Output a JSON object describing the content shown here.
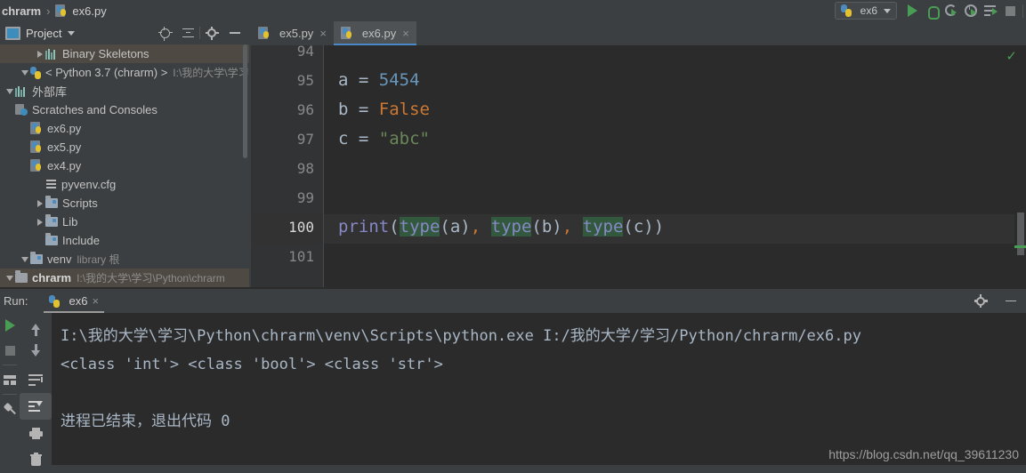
{
  "breadcrumb": {
    "project": "chrarm",
    "separator": "›",
    "file": "ex6.py"
  },
  "toolbar": {
    "run_config": "ex6",
    "buttons": [
      "run",
      "debug",
      "run-with-coverage",
      "profile",
      "run-console",
      "stop"
    ]
  },
  "project_panel": {
    "title": "Project",
    "tools": [
      "locate",
      "collapse-all",
      "settings",
      "hide"
    ],
    "tree": [
      {
        "label": "chrarm",
        "detail": "I:\\我的大学\\学习\\Python\\chrarm",
        "indent": 0,
        "twisty": "down",
        "icon": "folder",
        "bold": true,
        "selected": true
      },
      {
        "label": "venv",
        "detail": "library 根",
        "indent": 1,
        "twisty": "down",
        "icon": "folder-blue",
        "bold": false,
        "selected": false
      },
      {
        "label": "Include",
        "detail": "",
        "indent": 2,
        "twisty": "none",
        "icon": "folder-blue",
        "bold": false,
        "selected": false
      },
      {
        "label": "Lib",
        "detail": "",
        "indent": 2,
        "twisty": "right",
        "icon": "folder-blue",
        "bold": false,
        "selected": false
      },
      {
        "label": "Scripts",
        "detail": "",
        "indent": 2,
        "twisty": "right",
        "icon": "folder-blue",
        "bold": false,
        "selected": false
      },
      {
        "label": "pyvenv.cfg",
        "detail": "",
        "indent": 2,
        "twisty": "none",
        "icon": "config",
        "bold": false,
        "selected": false
      },
      {
        "label": "ex4.py",
        "detail": "",
        "indent": 1,
        "twisty": "none",
        "icon": "python-file",
        "bold": false,
        "selected": false
      },
      {
        "label": "ex5.py",
        "detail": "",
        "indent": 1,
        "twisty": "none",
        "icon": "python-file",
        "bold": false,
        "selected": false
      },
      {
        "label": "ex6.py",
        "detail": "",
        "indent": 1,
        "twisty": "none",
        "icon": "python-file",
        "bold": false,
        "selected": false
      },
      {
        "label": "Scratches and Consoles",
        "detail": "",
        "indent": 0,
        "twisty": "none",
        "icon": "scratch",
        "bold": false,
        "selected": false
      },
      {
        "label": "外部库",
        "detail": "",
        "indent": 0,
        "twisty": "down",
        "icon": "bars",
        "bold": false,
        "selected": false
      },
      {
        "label": "< Python 3.7 (chrarm) >",
        "detail": "I:\\我的大学\\学习",
        "indent": 1,
        "twisty": "down",
        "icon": "python",
        "bold": false,
        "selected": false
      },
      {
        "label": "Binary Skeletons",
        "detail": "",
        "indent": 2,
        "twisty": "right",
        "icon": "bars",
        "bold": false,
        "selected": true
      }
    ]
  },
  "editor": {
    "tabs": [
      {
        "label": "ex5.py",
        "active": false,
        "close": "×"
      },
      {
        "label": "ex6.py",
        "active": true,
        "close": "×"
      }
    ],
    "inspection_status": "✓",
    "lines": [
      {
        "number": "94",
        "current": false,
        "tokens": []
      },
      {
        "number": "95",
        "current": false,
        "tokens": [
          {
            "text": "a ",
            "cls": "punct"
          },
          {
            "text": "= ",
            "cls": "punct"
          },
          {
            "text": "5454",
            "cls": "num"
          }
        ]
      },
      {
        "number": "96",
        "current": false,
        "tokens": [
          {
            "text": "b ",
            "cls": "punct"
          },
          {
            "text": "= ",
            "cls": "punct"
          },
          {
            "text": "False",
            "cls": "kw"
          }
        ]
      },
      {
        "number": "97",
        "current": false,
        "tokens": [
          {
            "text": "c ",
            "cls": "punct"
          },
          {
            "text": "= ",
            "cls": "punct"
          },
          {
            "text": "\"abc\"",
            "cls": "str"
          }
        ]
      },
      {
        "number": "98",
        "current": false,
        "tokens": []
      },
      {
        "number": "99",
        "current": false,
        "tokens": []
      },
      {
        "number": "100",
        "current": true,
        "tokens": [
          {
            "text": "print",
            "cls": "fn"
          },
          {
            "text": "(",
            "cls": "punct"
          },
          {
            "text": "type",
            "cls": "fn hl"
          },
          {
            "text": "(a)",
            "cls": "punct"
          },
          {
            "text": ",",
            "cls": "comma"
          },
          {
            "text": " ",
            "cls": "punct"
          },
          {
            "text": "type",
            "cls": "fn hl"
          },
          {
            "text": "(b)",
            "cls": "punct"
          },
          {
            "text": ",",
            "cls": "comma"
          },
          {
            "text": " ",
            "cls": "punct"
          },
          {
            "text": "type",
            "cls": "fn hl"
          },
          {
            "text": "(c))",
            "cls": "punct"
          }
        ]
      },
      {
        "number": "101",
        "current": false,
        "tokens": []
      }
    ]
  },
  "run_panel": {
    "label": "Run:",
    "tab": "ex6",
    "tab_close": "×",
    "header_tools": [
      "settings",
      "hide"
    ],
    "left_tools": [
      "rerun",
      "stop",
      "restore-layout",
      "pin-tab"
    ],
    "side_tools": [
      "up",
      "down",
      "soft-wrap",
      "scroll-to-end",
      "print",
      "clear-all"
    ],
    "console_lines": [
      "I:\\我的大学\\学习\\Python\\chrarm\\venv\\Scripts\\python.exe I:/我的大学/学习/Python/chrarm/ex6.py",
      "<class 'int'> <class 'bool'> <class 'str'>",
      "",
      "进程已结束，退出代码 0"
    ]
  },
  "watermark": "https://blog.csdn.net/qq_39611230",
  "colors": {
    "background": "#3c3f41",
    "editor_background": "#2b2b2b",
    "accent_blue": "#4a88c7",
    "run_green": "#499c54",
    "string_green": "#6a8759",
    "number_blue": "#6897bb",
    "keyword_orange": "#cc7832",
    "function_violet": "#8888c6",
    "usage_highlight": "#32593d"
  }
}
